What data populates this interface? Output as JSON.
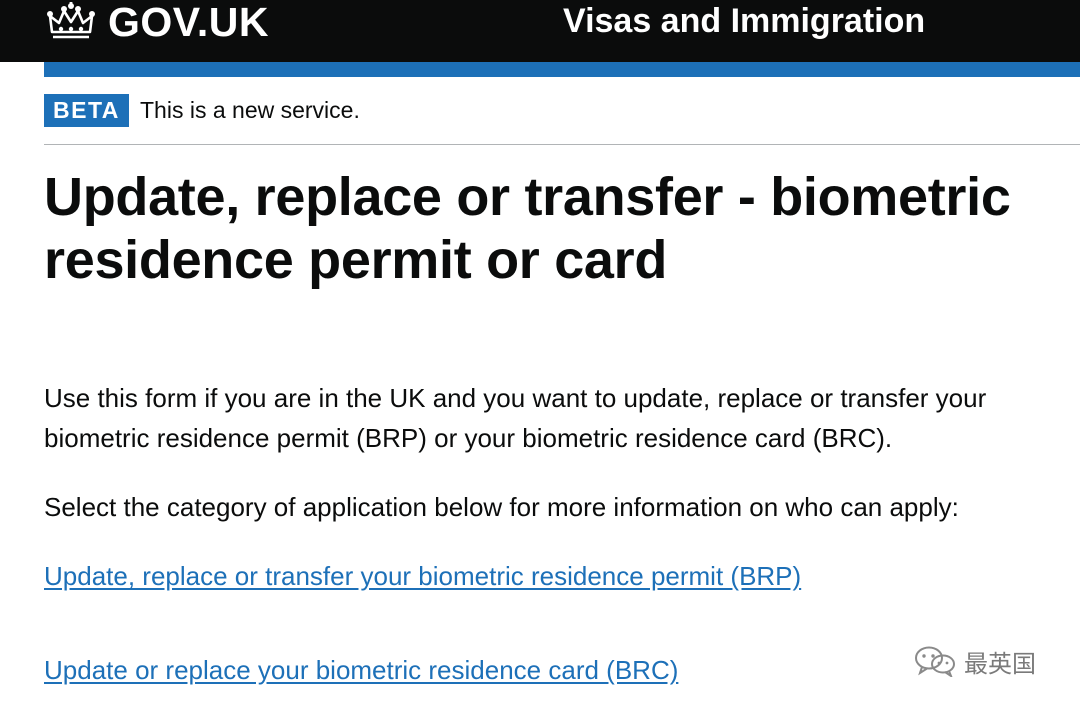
{
  "header": {
    "logo_text": "GOV.UK",
    "service_name": "Visas and Immigration"
  },
  "phase_banner": {
    "tag": "BETA",
    "text": "This is a new service."
  },
  "main": {
    "title": "Update, replace or transfer - biometric residence permit or card",
    "intro": "Use this form if you are in the UK and you want to update, replace or transfer your biometric residence permit (BRP) or your biometric residence card (BRC).",
    "select_prompt": "Select the category of application below for more information on who can apply:",
    "links": [
      "Update, replace or transfer your biometric residence permit (BRP)",
      "Update or replace your biometric residence card (BRC)"
    ]
  },
  "watermark": {
    "icon": "wechat-icon",
    "text": "最英国"
  },
  "colors": {
    "header_bg": "#0b0c0c",
    "brand_blue": "#1d70b8",
    "link": "#1d70b8",
    "text": "#0b0c0c"
  }
}
